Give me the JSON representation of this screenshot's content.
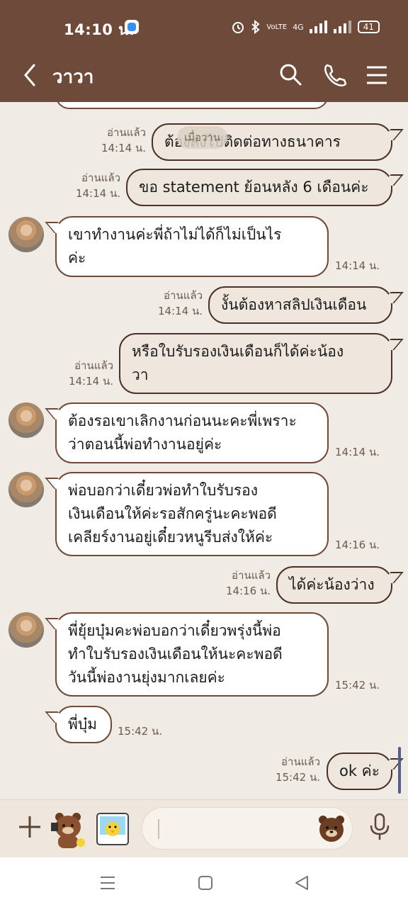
{
  "status_bar": {
    "time": "14:10 น.",
    "network": "4G",
    "volte": "VoLTE",
    "battery": "41"
  },
  "header": {
    "title": "วาวา"
  },
  "date_divider": "เมื่อวาน",
  "messages": [
    {
      "side": "me",
      "read_label": "อ่านแล้ว",
      "time": "14:14 น.",
      "lines": [
        "ต้องส่งไปติดต่อทางธนาคาร"
      ]
    },
    {
      "side": "me",
      "read_label": "อ่านแล้ว",
      "time": "14:14 น.",
      "lines": [
        "ขอ statement ย้อนหลัง 6 เดือนค่ะ"
      ]
    },
    {
      "side": "them",
      "time": "14:14 น.",
      "lines": [
        "เขาทำงานค่ะพี่ถ้าไม่ได้ก็ไม่เป็นไร",
        "ค่ะ"
      ]
    },
    {
      "side": "me",
      "read_label": "อ่านแล้ว",
      "time": "14:14 น.",
      "lines": [
        "งั้นต้องหาสลิปเงินเดือน"
      ]
    },
    {
      "side": "me",
      "read_label": "อ่านแล้ว",
      "time": "14:14 น.",
      "lines": [
        "หรือใบรับรองเงินเดือนก็ได้ค่ะน้อง",
        "วา"
      ]
    },
    {
      "side": "them",
      "time": "14:14 น.",
      "lines": [
        "ต้องรอเขาเลิกงานก่อนนะคะพี่เพราะ",
        "ว่าตอนนี้พ่อทำงานอยู่ค่ะ"
      ]
    },
    {
      "side": "them",
      "time": "14:16 น.",
      "lines": [
        "พ่อบอกว่าเดี๋ยวพ่อทำใบรับรอง",
        "เงินเดือนให้ค่ะรอสักครู่นะคะพอดี",
        "เคลียร์งานอยู่เดี๋ยวหนูรีบส่งให้ค่ะ"
      ]
    },
    {
      "side": "me",
      "read_label": "อ่านแล้ว",
      "time": "14:16 น.",
      "lines": [
        "ได้ค่ะน้องว่าง"
      ]
    },
    {
      "side": "them",
      "time": "15:42 น.",
      "lines": [
        "พี่ยุ้ยบุ๋มคะพ่อบอกว่าเดี๋ยวพรุ่งนี้พ่อ",
        "ทำใบรับรองเงินเดือนให้นะคะพอดี",
        "วันนี้พ่องานยุ่งมากเลยค่ะ"
      ]
    },
    {
      "side": "them",
      "time": "15:42 น.",
      "lines": [
        "พี่บุ๋ม"
      ]
    },
    {
      "side": "me",
      "read_label": "อ่านแล้ว",
      "time": "15:42 น.",
      "lines": [
        "ok ค่ะ"
      ]
    }
  ],
  "icons": {
    "back": "chevron-left-icon",
    "search": "search-icon",
    "call": "phone-icon",
    "menu": "menu-icon",
    "plus": "plus-icon",
    "mic": "microphone-icon",
    "emoji": "bear-emoji-icon"
  },
  "colors": {
    "header_bg": "#6e4a3a",
    "chat_bg": "#f0ebe5",
    "bubble_me": "#efe7dd",
    "bubble_them": "#ffffff",
    "bubble_border": "#6e4a3a"
  }
}
